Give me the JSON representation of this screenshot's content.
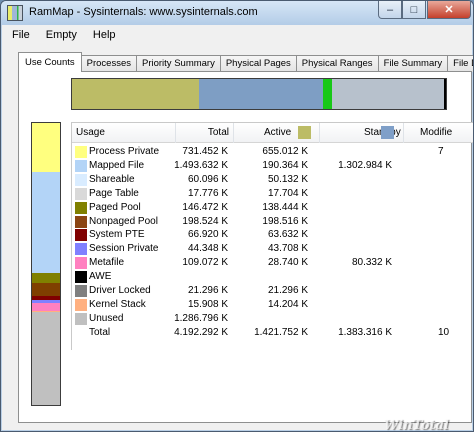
{
  "window": {
    "title": "RamMap - Sysinternals: www.sysinternals.com",
    "minimize_glyph": "–",
    "maximize_glyph": "□",
    "close_glyph": "✕"
  },
  "menu": [
    "File",
    "Empty",
    "Help"
  ],
  "tabs": [
    "Use Counts",
    "Processes",
    "Priority Summary",
    "Physical Pages",
    "Physical Ranges",
    "File Summary",
    "File Details"
  ],
  "active_tab": "Use Counts",
  "colors": {
    "active_swatch": "#bcbc66",
    "standby_swatch": "#7f9fc8",
    "modified_bar": "#18c818",
    "free_bar": "#b7c1cc"
  },
  "horizontal_bar": [
    {
      "label": "Active",
      "fraction": 0.34,
      "color": "#bcbc66"
    },
    {
      "label": "Standby",
      "fraction": 0.33,
      "color": "#7e9ec4"
    },
    {
      "label": "Modified",
      "fraction": 0.025,
      "color": "#18c818"
    },
    {
      "label": "Free",
      "fraction": 0.3,
      "color": "#b7c1cc"
    },
    {
      "label": "Other",
      "fraction": 0.005,
      "color": "#000000"
    }
  ],
  "vertical_bar": [
    {
      "label": "Process Private",
      "fraction": 0.175,
      "color": "#ffff7f"
    },
    {
      "label": "Mapped File",
      "fraction": 0.356,
      "color": "#b3d4f7"
    },
    {
      "label": "Paged Pool",
      "fraction": 0.035,
      "color": "#808000"
    },
    {
      "label": "Nonpaged Pool",
      "fraction": 0.047,
      "color": "#7f3f00"
    },
    {
      "label": "System PTE",
      "fraction": 0.016,
      "color": "#800000"
    },
    {
      "label": "Session Private",
      "fraction": 0.011,
      "color": "#8080ff"
    },
    {
      "label": "Metafile",
      "fraction": 0.026,
      "color": "#ff80c0"
    },
    {
      "label": "Kernel Stack",
      "fraction": 0.004,
      "color": "#ffb080"
    },
    {
      "label": "Unused",
      "fraction": 0.33,
      "color": "#c0c0c0"
    }
  ],
  "table": {
    "columns": [
      "Usage",
      "Total",
      "Active",
      "Standby",
      "Modifie"
    ],
    "rows": [
      {
        "usage": "Process Private",
        "color": "#ffff80",
        "total": "731.452 K",
        "active": "655.012 K",
        "standby": "",
        "modified": "7"
      },
      {
        "usage": "Mapped File",
        "color": "#b3d4f7",
        "total": "1.493.632 K",
        "active": "190.364 K",
        "standby": "1.302.984 K",
        "modified": ""
      },
      {
        "usage": "Shareable",
        "color": "#d9ecff",
        "total": "60.096 K",
        "active": "50.132 K",
        "standby": "",
        "modified": ""
      },
      {
        "usage": "Page Table",
        "color": "#d9d9d9",
        "total": "17.776 K",
        "active": "17.704 K",
        "standby": "",
        "modified": ""
      },
      {
        "usage": "Paged Pool",
        "color": "#808000",
        "total": "146.472 K",
        "active": "138.444 K",
        "standby": "",
        "modified": ""
      },
      {
        "usage": "Nonpaged Pool",
        "color": "#8b4513",
        "total": "198.524 K",
        "active": "198.516 K",
        "standby": "",
        "modified": ""
      },
      {
        "usage": "System PTE",
        "color": "#800000",
        "total": "66.920 K",
        "active": "63.632 K",
        "standby": "",
        "modified": ""
      },
      {
        "usage": "Session Private",
        "color": "#8080ff",
        "total": "44.348 K",
        "active": "43.708 K",
        "standby": "",
        "modified": ""
      },
      {
        "usage": "Metafile",
        "color": "#ff80c0",
        "total": "109.072 K",
        "active": "28.740 K",
        "standby": "80.332 K",
        "modified": ""
      },
      {
        "usage": "AWE",
        "color": "#000000",
        "total": "",
        "active": "",
        "standby": "",
        "modified": ""
      },
      {
        "usage": "Driver Locked",
        "color": "#808080",
        "total": "21.296 K",
        "active": "21.296 K",
        "standby": "",
        "modified": ""
      },
      {
        "usage": "Kernel Stack",
        "color": "#ffb080",
        "total": "15.908 K",
        "active": "14.204 K",
        "standby": "",
        "modified": ""
      },
      {
        "usage": "Unused",
        "color": "#c0c0c0",
        "total": "1.286.796 K",
        "active": "",
        "standby": "",
        "modified": ""
      },
      {
        "usage": "Total",
        "color": "",
        "total": "4.192.292 K",
        "active": "1.421.752 K",
        "standby": "1.383.316 K",
        "modified": "10"
      }
    ]
  },
  "watermark": "WinTotal"
}
